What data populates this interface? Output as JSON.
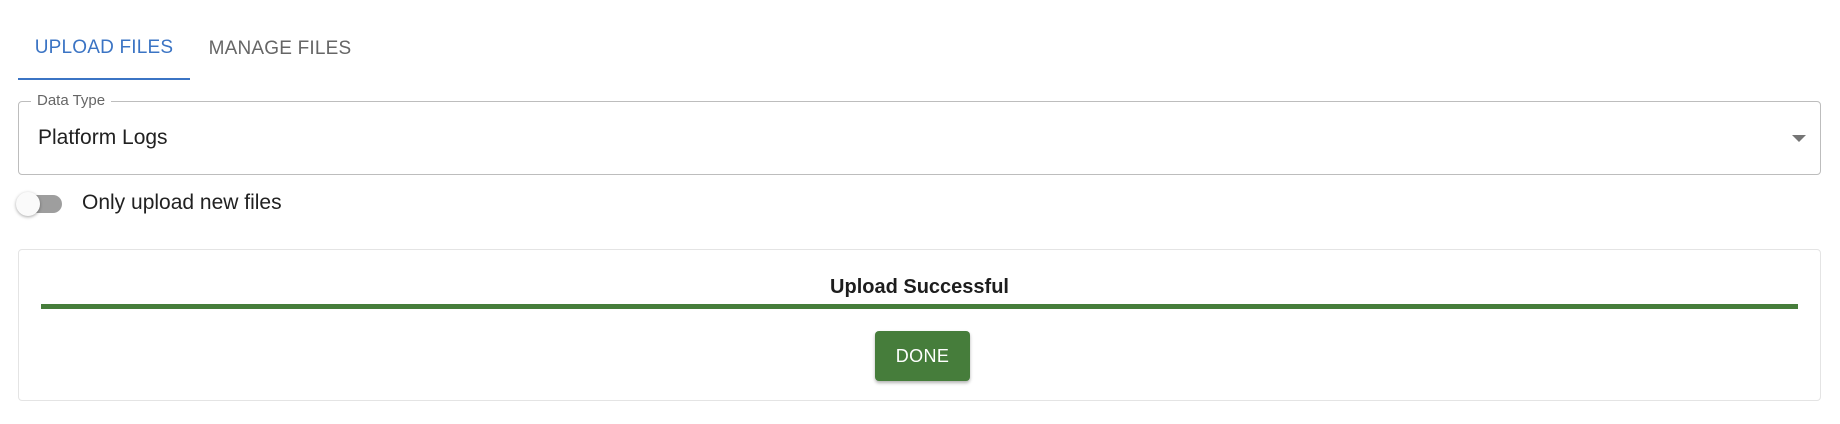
{
  "tabs": [
    {
      "label": "UPLOAD FILES",
      "active": true
    },
    {
      "label": "MANAGE FILES",
      "active": false
    }
  ],
  "data_type": {
    "label": "Data Type",
    "value": "Platform Logs",
    "arrow_icon": "arrow-drop-down-icon"
  },
  "toggle": {
    "label": "Only upload new files",
    "checked": false
  },
  "result": {
    "title": "Upload Successful",
    "progress": 1.0,
    "done_label": "DONE"
  },
  "colors": {
    "accent": "#3b74c4",
    "success": "#467d3b",
    "tab_inactive": "#666666",
    "switch_off_track": "#9e9e9e"
  }
}
